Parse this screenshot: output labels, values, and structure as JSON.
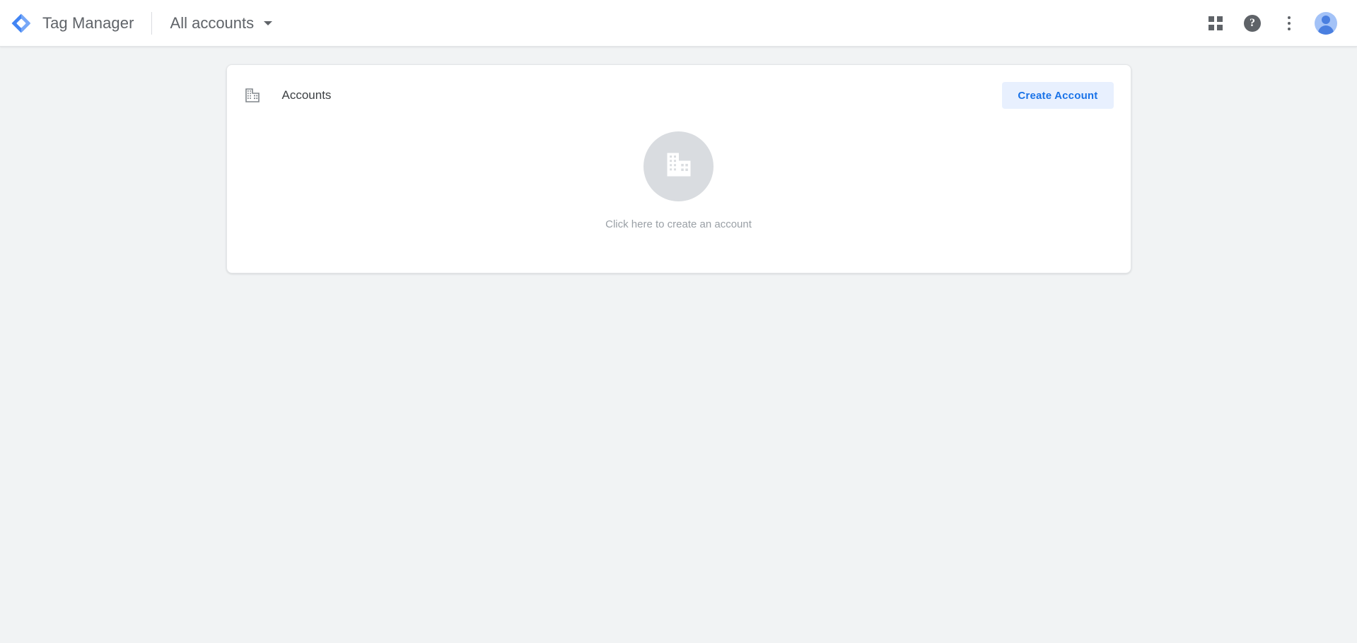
{
  "header": {
    "logo_icon": "tag-manager-logo-icon",
    "brand_title": "Tag Manager",
    "account_selector_label": "All accounts",
    "caret_icon": "chevron-down-icon",
    "apps_icon": "apps-grid-icon",
    "help_icon": "help-question-icon",
    "help_glyph": "?",
    "more_icon": "more-vertical-icon",
    "avatar_icon": "user-avatar-icon"
  },
  "main": {
    "card": {
      "icon": "building-domain-icon",
      "title": "Accounts",
      "create_button_label": "Create Account",
      "empty_state": {
        "icon": "building-domain-icon",
        "caption": "Click here to create an account"
      }
    }
  },
  "colors": {
    "accent_blue": "#1a73e8",
    "button_bg": "#e8f0fe",
    "page_bg": "#f1f3f4",
    "card_bg": "#ffffff",
    "text_primary": "#3c4043",
    "text_secondary": "#5f6368",
    "text_muted": "#9aa0a6",
    "empty_circle": "#d9dce0",
    "logo_outer": "#8ab4f8",
    "logo_inner": "#4285f4"
  }
}
